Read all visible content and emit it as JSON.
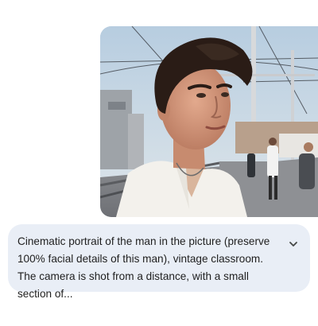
{
  "message": {
    "prompt_text": "Cinematic portrait of the man in the picture (preserve 100% facial details of this man), vintage classroom. The camera is shot from a distance, with a small section of...",
    "expand_icon": "chevron-down-icon"
  },
  "attachment": {
    "kind": "photo",
    "subject": "man"
  },
  "colors": {
    "bubble_background": "#e9eef6",
    "text": "#1f1f1f",
    "page_background": "#ffffff"
  }
}
